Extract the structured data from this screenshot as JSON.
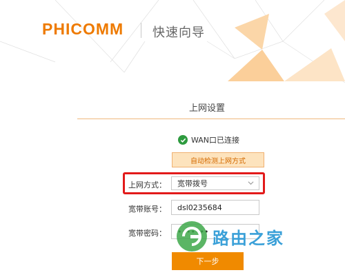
{
  "header": {
    "logo": "PHICOMM",
    "title": "快速向导"
  },
  "section": {
    "title": "上网设置"
  },
  "status": {
    "text": "WAN口已连接"
  },
  "detect_button": "自动检测上网方式",
  "connection_type": {
    "label": "上网方式：",
    "value": "宽带拨号"
  },
  "account": {
    "label": "宽带账号：",
    "value": "dsl0235684"
  },
  "password": {
    "label": "宽带密码：",
    "value": "•••••••"
  },
  "next_button": "下一步",
  "watermark": "路由之家",
  "colors": {
    "accent": "#ee7a00",
    "highlight": "#e21a1a",
    "success": "#2e9b3f"
  }
}
